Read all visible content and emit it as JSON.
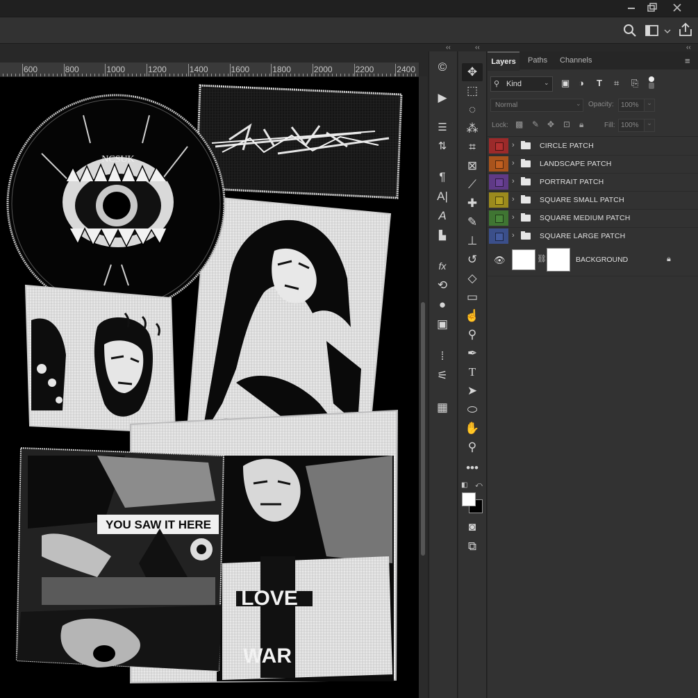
{
  "window": {
    "minimize_icon": "minimize-icon",
    "restore_icon": "restore-icon",
    "close_icon": "close-icon"
  },
  "optionsbar": {
    "search_icon": "search-icon",
    "workspace_icon": "workspace-icon",
    "share_icon": "share-icon"
  },
  "ruler": {
    "ticks": [
      "600",
      "800",
      "1000",
      "1200",
      "1400",
      "1600",
      "1800",
      "2000",
      "2200",
      "2400"
    ]
  },
  "artwork": {
    "circle_patch_text": "NCSUK",
    "collage_caption": "YOU SAW IT HERE",
    "poster_line1": "LOVE",
    "poster_line2": "WAR"
  },
  "panels": {
    "collapse_left": "‹‹",
    "collapse_mid": "‹‹",
    "collapse_right": "‹‹"
  },
  "layers_panel": {
    "tabs": [
      {
        "label": "Layers",
        "active": true
      },
      {
        "label": "Paths",
        "active": false
      },
      {
        "label": "Channels",
        "active": false
      }
    ],
    "kind_filter": "Kind",
    "blend_mode": "Normal",
    "opacity_label": "Opacity:",
    "opacity_value": "100%",
    "lock_label": "Lock:",
    "fill_label": "Fill:",
    "fill_value": "100%",
    "layers": [
      {
        "name": "CIRCLE PATCH",
        "color": "#9b2a2a"
      },
      {
        "name": "LANDSCAPE PATCH",
        "color": "#a8531c"
      },
      {
        "name": "PORTRAIT PATCH",
        "color": "#5f3a86"
      },
      {
        "name": "SQUARE SMALL PATCH",
        "color": "#9b8a1d"
      },
      {
        "name": "SQUARE MEDIUM PATCH",
        "color": "#3f7532"
      },
      {
        "name": "SQUARE LARGE PATCH",
        "color": "#3b4f8a"
      }
    ],
    "background_layer": "BACKGROUND"
  }
}
